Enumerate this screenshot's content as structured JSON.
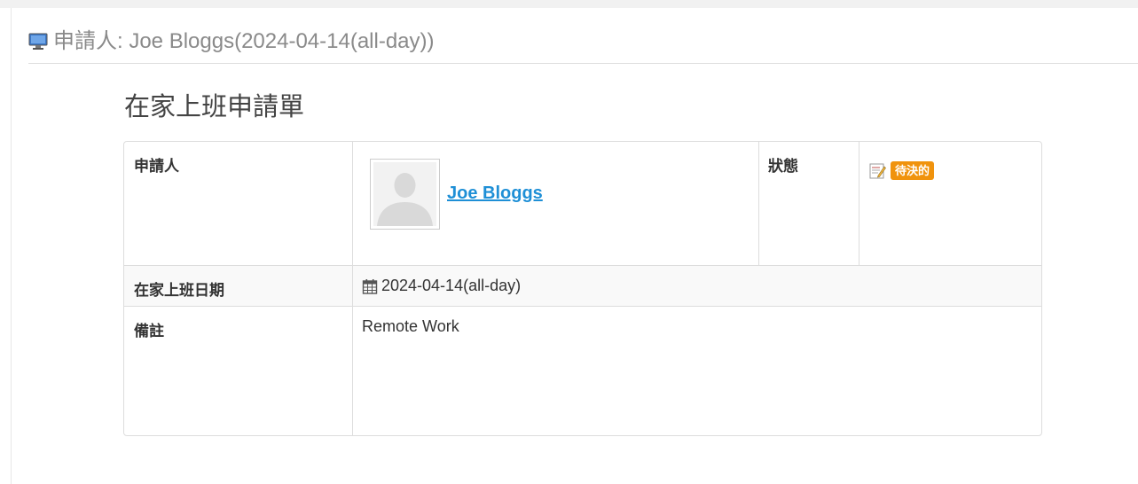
{
  "header": {
    "title": "申請人: Joe Bloggs(2024-04-14(all-day))",
    "icon": "monitor-icon"
  },
  "form": {
    "title": "在家上班申請單",
    "applicant_label": "申請人",
    "applicant_name": "Joe Bloggs",
    "status_label": "狀態",
    "status_value": "待決的",
    "status_color": "#f0930d",
    "date_label": "在家上班日期",
    "date_value": "2024-04-14(all-day)",
    "note_label": "備註",
    "note_value": "Remote Work"
  },
  "colors": {
    "link": "#1e8fd6",
    "header_text": "#8a8a8a",
    "border": "#dddddd"
  }
}
